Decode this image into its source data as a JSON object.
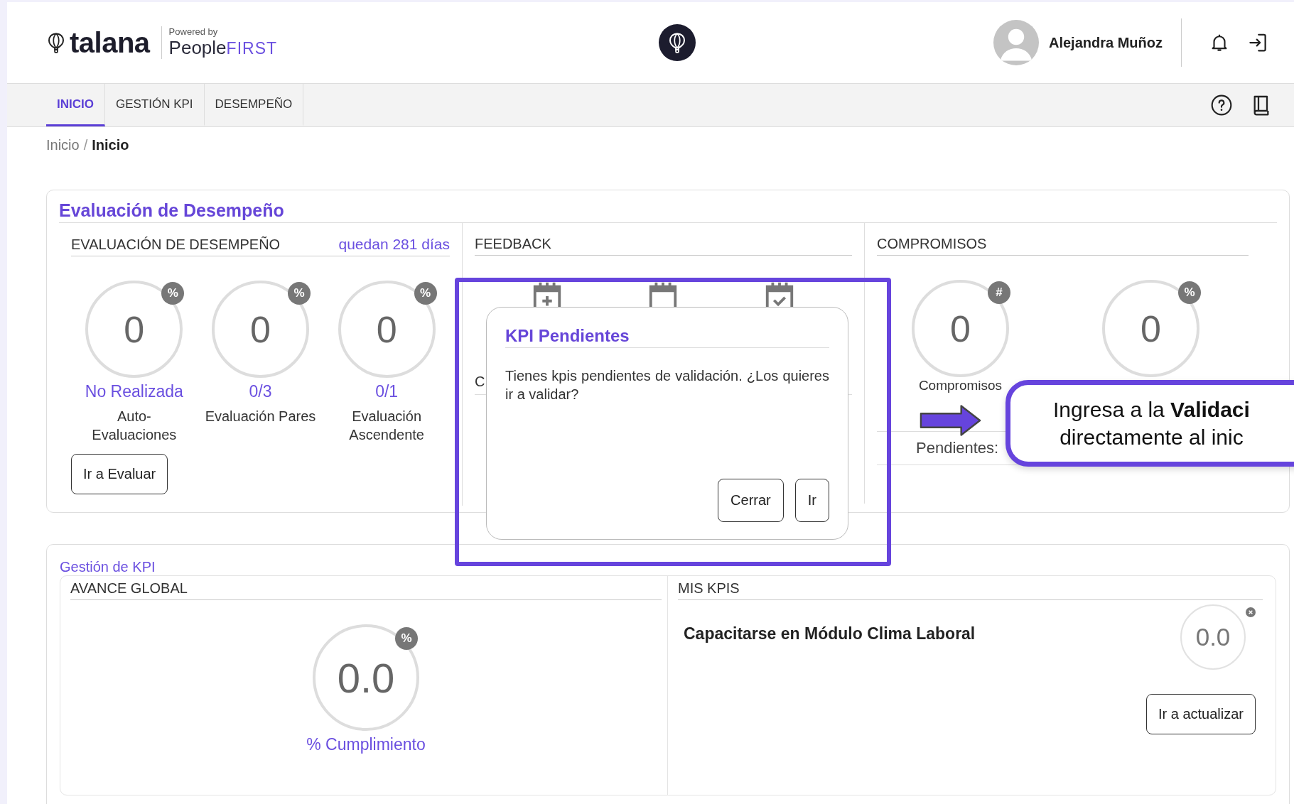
{
  "header": {
    "logo_text": "talana",
    "powered_by": "Powered by",
    "partner_name": "People",
    "partner_suffix": "FIRST",
    "user_name": "Alejandra Muñoz"
  },
  "nav": {
    "tabs": [
      {
        "label": "INICIO",
        "selected": true
      },
      {
        "label": "GESTIÓN KPI",
        "selected": false
      },
      {
        "label": "DESEMPEÑO",
        "selected": false
      }
    ]
  },
  "breadcrumb_separator": "/",
  "breadcrumb": [
    {
      "label": "Inicio",
      "current": false
    },
    {
      "label": "Inicio",
      "current": true
    }
  ],
  "performance_card": {
    "title": "Evaluación de Desempeño",
    "evaluation": {
      "heading": "EVALUACIÓN DE DESEMPEÑO",
      "remaining": "quedan 281 días",
      "button": "Ir a Evaluar",
      "gauges": [
        {
          "value": "0",
          "badge": "%",
          "status": "No Realizada",
          "label": "Auto-\nEvaluaciones"
        },
        {
          "value": "0",
          "badge": "%",
          "status": "0/3",
          "label": "Evaluación Pares"
        },
        {
          "value": "0",
          "badge": "%",
          "status": "0/1",
          "label": "Evaluación\nAscendente"
        }
      ]
    },
    "feedback": {
      "heading": "FEEDBACK",
      "label": "C"
    },
    "commitments": {
      "heading": "COMPROMISOS",
      "pending": "Pendientes:",
      "gauges": [
        {
          "value": "0",
          "badge": "#",
          "label": "Compromisos"
        },
        {
          "value": "0",
          "badge": "%"
        }
      ]
    }
  },
  "kpi_card": {
    "title": "Gestión de KPI",
    "global": {
      "heading": "AVANCE GLOBAL",
      "value": "0.0",
      "badge": "%",
      "label": "% Cumplimiento"
    },
    "my_kpis": {
      "heading": "MIS KPIS",
      "button": "Ir a actualizar",
      "items": [
        {
          "name": "Capacitarse en Módulo Clima Laboral",
          "value": "0.0"
        }
      ]
    }
  },
  "dialog": {
    "title": "KPI Pendientes",
    "message": "Tienes kpis pendientes de validación. ¿Los quieres ir a validar?",
    "buttons": [
      "Cerrar",
      "Ir"
    ]
  },
  "callout": {
    "text": "Ingresa a la **Validaci**\ndirectamente al inic"
  }
}
